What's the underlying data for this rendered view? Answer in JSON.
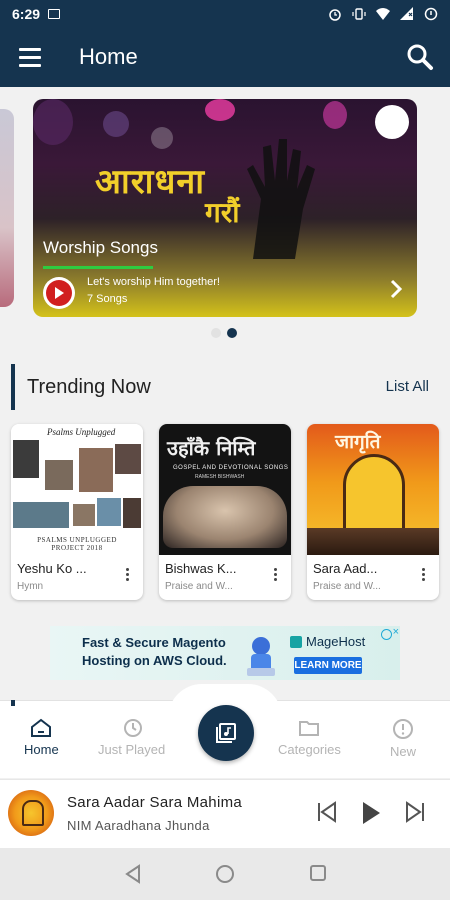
{
  "status_bar": {
    "time": "6:29",
    "icons": [
      "image-icon",
      "alarm-icon",
      "vibrate-icon",
      "wifi-icon",
      "signal-icon",
      "battery-icon"
    ]
  },
  "app_bar": {
    "title": "Home",
    "menu_icon": "hamburger-menu-icon",
    "search_icon": "search-icon"
  },
  "banner": {
    "artwork_text_line1": "आराधना",
    "artwork_text_line2": "गरौं",
    "title": "Worship Songs",
    "description": "Let's worship Him together!",
    "count": "7 Songs",
    "pager": {
      "total": 2,
      "active_index": 1
    }
  },
  "trending": {
    "title": "Trending Now",
    "list_all_label": "List All",
    "items": [
      {
        "title": "Yeshu Ko ...",
        "subtitle": "Hymn",
        "art_caption": "PSALMS UNPLUGGED",
        "art_caption2": "PROJECT 2018",
        "art_script": "Psalms Unplugged"
      },
      {
        "title": "Bishwas K...",
        "subtitle": "Praise and W...",
        "art_title": "उहाँकै निम्ति",
        "art_subtitle": "GOSPEL AND DEVOTIONAL SONGS",
        "art_artist": "RAMESH BISHWASH"
      },
      {
        "title": "Sara Aad...",
        "subtitle": "Praise and W...",
        "art_title": "जागृति"
      }
    ]
  },
  "ad": {
    "headline_line1": "Fast & Secure Magento",
    "headline_line2": "Hosting on AWS Cloud.",
    "brand": "MageHost",
    "cta": "LEARN MORE"
  },
  "bottom_nav": {
    "items": [
      {
        "label": "Home",
        "icon": "home-icon",
        "active": true
      },
      {
        "label": "Just Played",
        "icon": "history-icon",
        "active": false
      },
      {
        "label": "Categories",
        "icon": "folder-icon",
        "active": false
      },
      {
        "label": "New",
        "icon": "alert-circle-icon",
        "active": false
      }
    ],
    "center_icon": "library-music-icon"
  },
  "player": {
    "title": "Sara Aadar Sara Mahima",
    "artist": "NIM Aaradhana Jhunda"
  },
  "colors": {
    "primary": "#15344f",
    "accent_green": "#2ecc40",
    "play_red": "#d11f1f"
  }
}
